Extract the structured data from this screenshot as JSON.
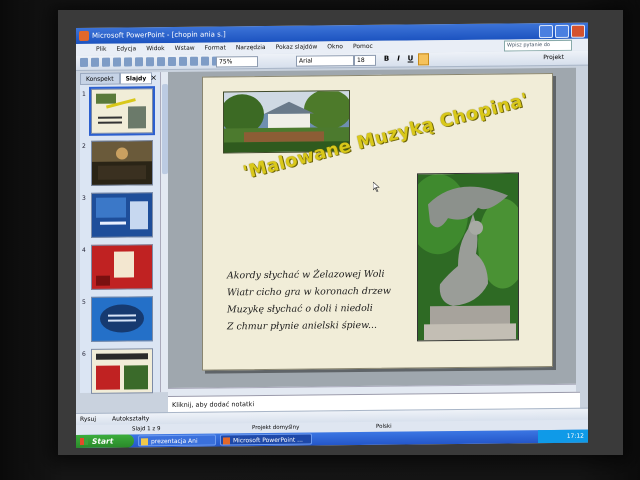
{
  "app": {
    "title": "Microsoft PowerPoint - [chopin ania s.]"
  },
  "menu": {
    "items": [
      "Plik",
      "Edycja",
      "Widok",
      "Wstaw",
      "Format",
      "Narzędzia",
      "Pokaz slajdów",
      "Okno",
      "Pomoc"
    ],
    "help_placeholder": "Wpisz pytanie do Pomocy"
  },
  "toolbar": {
    "zoom": "75%",
    "font": "Arial",
    "font_size": "18",
    "bold": "B",
    "italic": "I",
    "underline": "U",
    "project": "Projekt"
  },
  "panes": {
    "tab_outline": "Konspekt",
    "tab_slides": "Slajdy",
    "close": "×",
    "thumbnails": [
      {
        "num": "1",
        "selected": true
      },
      {
        "num": "2",
        "selected": false
      },
      {
        "num": "3",
        "selected": false
      },
      {
        "num": "4",
        "selected": false
      },
      {
        "num": "5",
        "selected": false
      },
      {
        "num": "6",
        "selected": false
      }
    ]
  },
  "slide": {
    "title": "'Malowane Muzyką Chopina'",
    "poem": [
      "Akordy słychać w Żelazowej Woli",
      "Wiatr cicho gra w koronach drzew",
      "Muzykę słychać o doli i niedoli",
      "Z chmur płynie anielski śpiew..."
    ]
  },
  "notes": {
    "placeholder": "Kliknij, aby dodać notatki"
  },
  "drawbar": {
    "draw": "Rysuj",
    "autoshapes": "Autokształty"
  },
  "status": {
    "slide": "Slajd 1 z 9",
    "design": "Projekt domyślny",
    "language": "Polski"
  },
  "taskbar": {
    "start": "Start",
    "tasks": [
      "prezentacja Ani",
      "Microsoft PowerPoint ..."
    ],
    "clock": "17:12"
  },
  "colors": {
    "title_gold": "#d9c81a",
    "xp_blue": "#2456c9",
    "start_green": "#3cad3c"
  }
}
